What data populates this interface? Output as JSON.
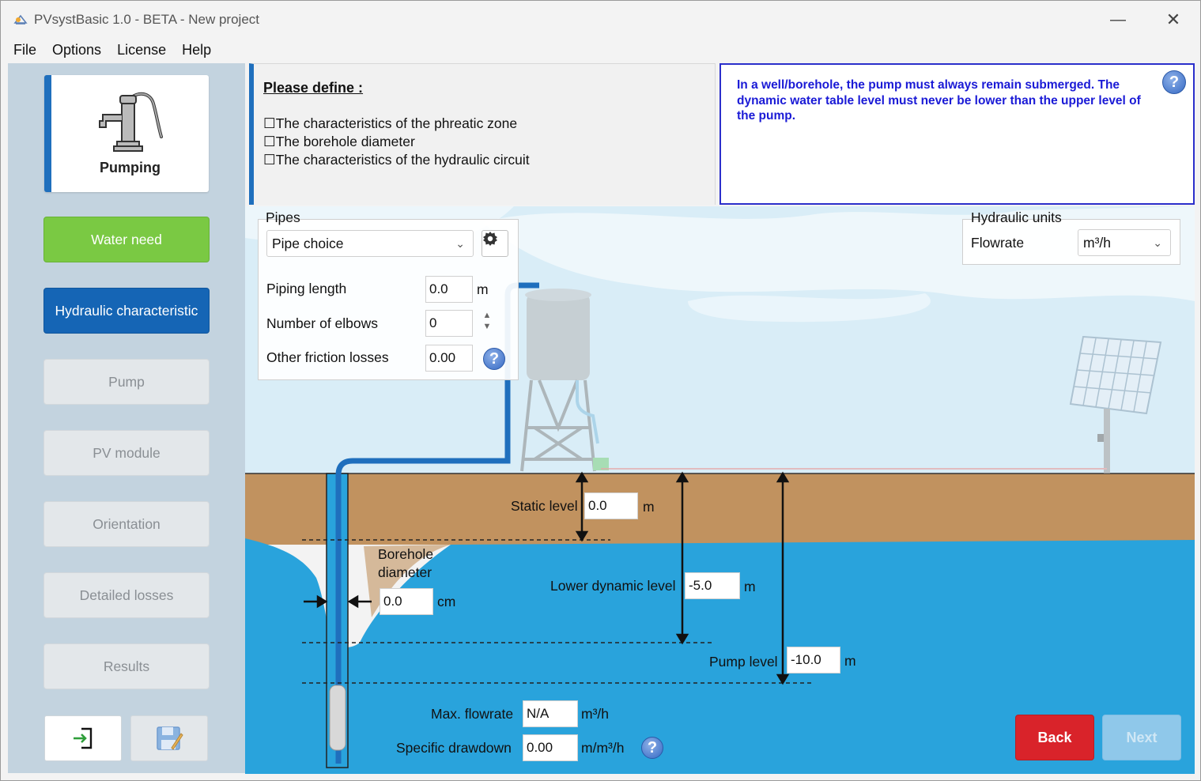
{
  "window": {
    "title": "PVsystBasic 1.0 - BETA - New project",
    "minimize_glyph": "—",
    "close_glyph": "✕"
  },
  "menu": [
    "File",
    "Options",
    "License",
    "Help"
  ],
  "sidebar": {
    "current_step": "Pumping",
    "steps": [
      {
        "label": "Water need",
        "state": "done"
      },
      {
        "label": "Hydraulic characteristic",
        "state": "active"
      },
      {
        "label": "Pump",
        "state": "disabled"
      },
      {
        "label": "PV module",
        "state": "disabled"
      },
      {
        "label": "Orientation",
        "state": "disabled"
      },
      {
        "label": "Detailed losses",
        "state": "disabled"
      },
      {
        "label": "Results",
        "state": "disabled"
      }
    ],
    "bottom_icons": [
      "exit-icon",
      "save-icon"
    ]
  },
  "define_panel": {
    "title": "Please define :",
    "items": [
      "The characteristics of the phreatic zone",
      "The borehole diameter",
      "The characteristics of the hydraulic circuit"
    ]
  },
  "tip_panel": {
    "text": "In a well/borehole, the pump must always remain submerged. The dynamic water table level must never be lower than the upper level of the pump.",
    "help_glyph": "?"
  },
  "pipes": {
    "legend": "Pipes",
    "choice": "Pipe choice",
    "piping_length_label": "Piping length",
    "piping_length_value": "0.0",
    "piping_length_unit": "m",
    "elbows_label": "Number of elbows",
    "elbows_value": "0",
    "friction_label": "Other friction losses",
    "friction_value": "0.00"
  },
  "hydraulic_units": {
    "legend": "Hydraulic units",
    "flowrate_label": "Flowrate",
    "flowrate_unit": "m³/h"
  },
  "levels": {
    "static_label": "Static level",
    "static_value": "0.0",
    "static_unit": "m",
    "dynamic_label": "Lower dynamic level",
    "dynamic_value": "-5.0",
    "dynamic_unit": "m",
    "pump_label": "Pump level",
    "pump_value": "-10.0",
    "pump_unit": "m"
  },
  "borehole": {
    "label_line1": "Borehole",
    "label_line2": "diameter",
    "value": "0.0",
    "unit": "cm"
  },
  "results": {
    "max_flow_label": "Max. flowrate",
    "max_flow_value": "N/A",
    "max_flow_unit": "m³/h",
    "drawdown_label": "Specific drawdown",
    "drawdown_value": "0.00",
    "drawdown_unit": "m/m³/h"
  },
  "buttons": {
    "back": "Back",
    "next": "Next"
  },
  "colors": {
    "accent_blue": "#1565b5",
    "done_green": "#7ac943",
    "back_red": "#d9232a",
    "next_disabled": "#8fc8ea",
    "water": "#29a3dc",
    "soil": "#c1925f",
    "tip_text": "#1a1ad6"
  }
}
